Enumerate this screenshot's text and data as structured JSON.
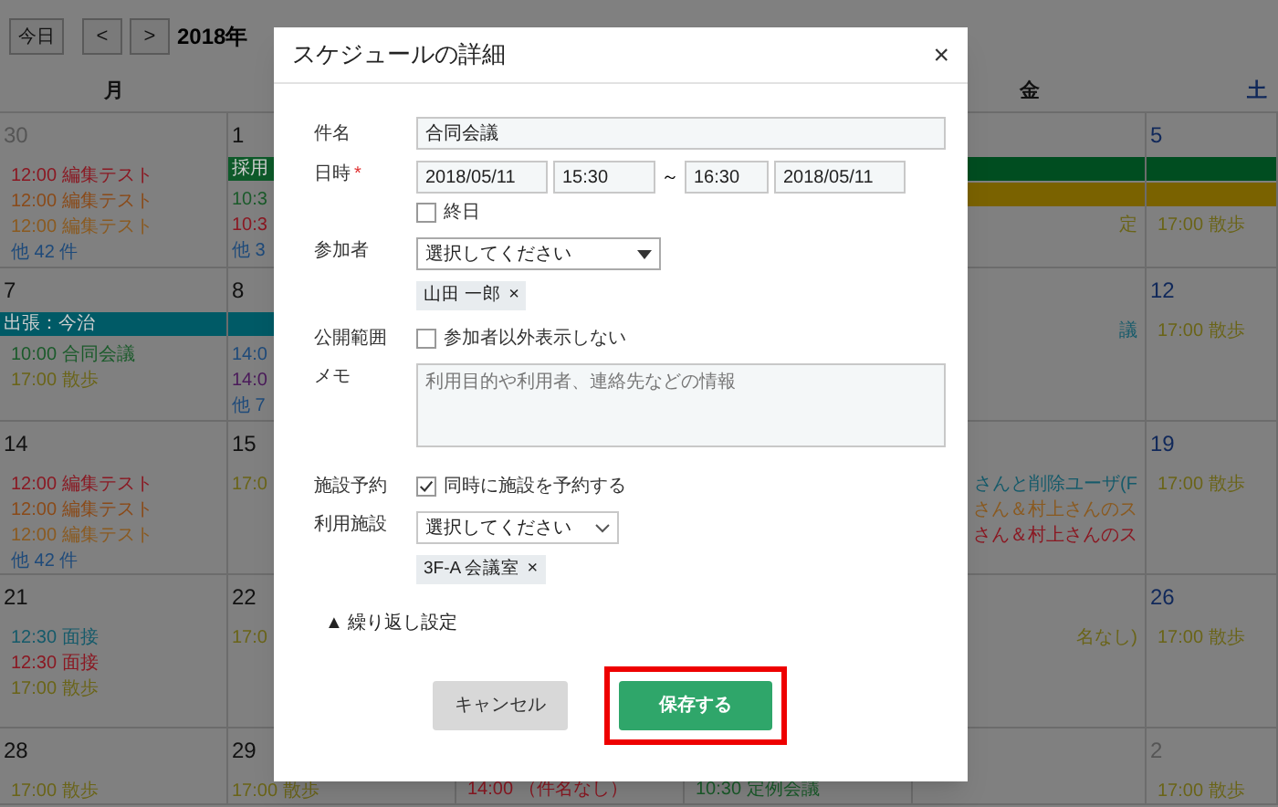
{
  "calendar": {
    "today_button": "今日",
    "prev_button": "<",
    "next_button": ">",
    "month_label": "2018年",
    "weekdays": [
      {
        "label": "月",
        "kind": "monday"
      },
      {
        "label": "金",
        "kind": "friday"
      },
      {
        "label": "土",
        "kind": "saturday"
      }
    ],
    "weeks": [
      {
        "cells": [
          {
            "date": "30",
            "muted": true,
            "events": [
              {
                "text": "12:00 編集テスト",
                "color": "#8a1822"
              },
              {
                "text": "12:00 編集テスト",
                "color": "#8a4a18"
              },
              {
                "text": "12:00 編集テスト",
                "color": "#8a5a20"
              }
            ],
            "more": "他 42 件"
          },
          {
            "date": "1",
            "muted": false,
            "bars": [
              {
                "text": "採用",
                "color": "#0e5a2a"
              }
            ],
            "events": [
              {
                "text": "10:3",
                "color": "#1a5a2a"
              },
              {
                "text": "10:3",
                "color": "#8a1822"
              }
            ],
            "more": "他 3"
          },
          {},
          {},
          {
            "bars": [
              {
                "color": "#004d20"
              },
              {
                "color": "#7a6200"
              }
            ],
            "events": [
              {
                "text": "定",
                "color": "#6a6418"
              }
            ]
          },
          {
            "date": "5",
            "muted": false,
            "bars": [
              {
                "color": "#004d20"
              },
              {
                "color": "#7a6200"
              }
            ],
            "events": [
              {
                "text": "17:00 散歩",
                "color": "#6a6418"
              }
            ]
          }
        ]
      },
      {
        "cells": [
          {
            "date": "7",
            "muted": false,
            "bars": [
              {
                "text": "出張：今治",
                "color": "#005a66"
              }
            ],
            "events": [
              {
                "text": "10:00 合同会議",
                "color": "#1a5a2a"
              },
              {
                "text": "17:00 散歩",
                "color": "#6a6418"
              }
            ]
          },
          {
            "date": "8",
            "muted": false,
            "bars": [
              {
                "color": "#005a66"
              }
            ],
            "events": [
              {
                "text": "14:0",
                "color": "#1e4a7a"
              },
              {
                "text": "14:0",
                "color": "#4a1a5a"
              }
            ],
            "more": "他 7"
          },
          {},
          {},
          {
            "events": [
              {
                "text": "議",
                "color": "#155a6a"
              }
            ]
          },
          {
            "date": "12",
            "muted": false,
            "events": [
              {
                "text": "17:00 散歩",
                "color": "#6a6418"
              }
            ]
          }
        ]
      },
      {
        "cells": [
          {
            "date": "14",
            "muted": false,
            "events": [
              {
                "text": "12:00 編集テスト",
                "color": "#8a1822"
              },
              {
                "text": "12:00 編集テスト",
                "color": "#8a4a18"
              },
              {
                "text": "12:00 編集テスト",
                "color": "#8a5a20"
              }
            ],
            "more": "他 42 件"
          },
          {
            "date": "15",
            "muted": false,
            "events": [
              {
                "text": "17:0",
                "color": "#6a6418"
              }
            ]
          },
          {},
          {},
          {
            "events": [
              {
                "text": "さんと削除ユーザ(F",
                "color": "#155a6a"
              },
              {
                "text": "さん＆村上さんのス",
                "color": "#8a5a20"
              },
              {
                "text": "さん＆村上さんのス",
                "color": "#8a1822"
              }
            ]
          },
          {
            "date": "19",
            "muted": false,
            "events": [
              {
                "text": "17:00 散歩",
                "color": "#6a6418"
              }
            ]
          }
        ]
      },
      {
        "cells": [
          {
            "date": "21",
            "muted": false,
            "events": [
              {
                "text": "12:30 面接",
                "color": "#155a6a"
              },
              {
                "text": "12:30 面接",
                "color": "#8a1822"
              },
              {
                "text": "17:00 散歩",
                "color": "#6a6418"
              }
            ]
          },
          {
            "date": "22",
            "muted": false,
            "events": [
              {
                "text": "17:0",
                "color": "#6a6418"
              }
            ]
          },
          {},
          {},
          {
            "events": [
              {
                "text": "名なし)",
                "color": "#6a6418"
              }
            ]
          },
          {
            "date": "26",
            "muted": false,
            "events": [
              {
                "text": "17:00 散歩",
                "color": "#6a6418"
              }
            ]
          }
        ]
      },
      {
        "cells": [
          {
            "date": "28",
            "muted": false,
            "events": [
              {
                "text": "17:00 散歩",
                "color": "#6a6418"
              }
            ]
          },
          {
            "date": "29",
            "muted": false,
            "events": [
              {
                "text": "17:00 散歩",
                "color": "#6a6418"
              }
            ]
          },
          {
            "events": [
              {
                "text": "14:00 （件名なし）",
                "color": "#8a1822"
              }
            ]
          },
          {
            "events": [
              {
                "text": "10:30 定例会議",
                "color": "#1a5a2a"
              }
            ]
          },
          {},
          {
            "date": "2",
            "muted": true,
            "events": [
              {
                "text": "17:00 散歩",
                "color": "#6a6418"
              }
            ]
          }
        ]
      }
    ]
  },
  "dialog": {
    "title": "スケジュールの詳細",
    "close": "×",
    "subject": {
      "label": "件名",
      "value": "合同会議"
    },
    "datetime": {
      "label": "日時",
      "required_mark": "*",
      "start_date": "2018/05/11",
      "start_time": "15:30",
      "separator": "～",
      "end_time": "16:30",
      "end_date": "2018/05/11",
      "all_day": {
        "label": "終日",
        "checked": false
      }
    },
    "participants": {
      "label": "参加者",
      "value": "選択してください",
      "chips": [
        {
          "label": "山田 一郎",
          "remove": "×"
        }
      ]
    },
    "visibility": {
      "label": "公開範囲",
      "checkbox": {
        "label": "参加者以外表示しない",
        "checked": false
      }
    },
    "memo": {
      "label": "メモ",
      "placeholder": "利用目的や利用者、連絡先などの情報"
    },
    "facility_booking": {
      "label": "施設予約",
      "checkbox": {
        "label": "同時に施設を予約する",
        "checked": true
      }
    },
    "facility": {
      "label": "利用施設",
      "value": "選択してください",
      "chips": [
        {
          "label": "3F-A 会議室",
          "remove": "×"
        }
      ]
    },
    "repeat": {
      "label": "▲ 繰り返し設定"
    },
    "buttons": {
      "cancel": "キャンセル",
      "save": "保存する"
    },
    "save_highlighted": true
  }
}
